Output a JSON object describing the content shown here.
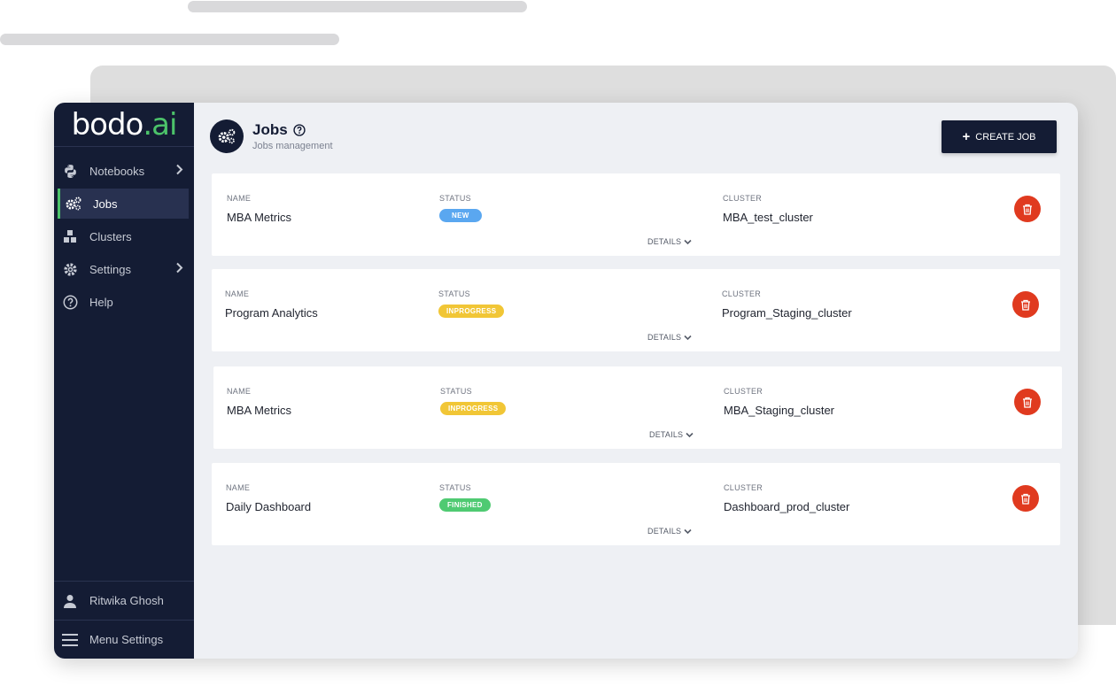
{
  "brand": {
    "logo_main": "bodo",
    "logo_dot": ".",
    "logo_accent": "ai"
  },
  "sidebar": {
    "items": [
      {
        "label": "Notebooks",
        "icon": "python-icon",
        "has_chevron": true,
        "active": false
      },
      {
        "label": "Jobs",
        "icon": "gears-icon",
        "has_chevron": false,
        "active": true
      },
      {
        "label": "Clusters",
        "icon": "clusters-icon",
        "has_chevron": false,
        "active": false
      },
      {
        "label": "Settings",
        "icon": "gear-icon",
        "has_chevron": true,
        "active": false
      },
      {
        "label": "Help",
        "icon": "help-icon",
        "has_chevron": false,
        "active": false
      }
    ],
    "user_name": "Ritwika Ghosh",
    "menu_settings_label": "Menu Settings"
  },
  "header": {
    "title": "Jobs",
    "subtitle": "Jobs management",
    "create_button": "CREATE JOB"
  },
  "jobs_labels": {
    "name": "NAME",
    "status": "STATUS",
    "cluster": "CLUSTER",
    "details": "DETAILS"
  },
  "jobs": [
    {
      "name": "MBA Metrics",
      "status": "NEW",
      "cluster": "MBA_test_cluster"
    },
    {
      "name": "Program Analytics",
      "status": "INPROGRESS",
      "cluster": "Program_Staging_cluster"
    },
    {
      "name": "MBA Metrics",
      "status": "INPROGRESS",
      "cluster": "MBA_Staging_cluster"
    },
    {
      "name": "Daily Dashboard",
      "status": "FINISHED",
      "cluster": "Dashboard_prod_cluster"
    }
  ],
  "colors": {
    "sidebar_bg": "#141c34",
    "accent_green": "#4cc36a",
    "status_new": "#5aa7f0",
    "status_inprogress": "#f1c636",
    "status_finished": "#4fca72",
    "delete_red": "#e03a1f"
  }
}
